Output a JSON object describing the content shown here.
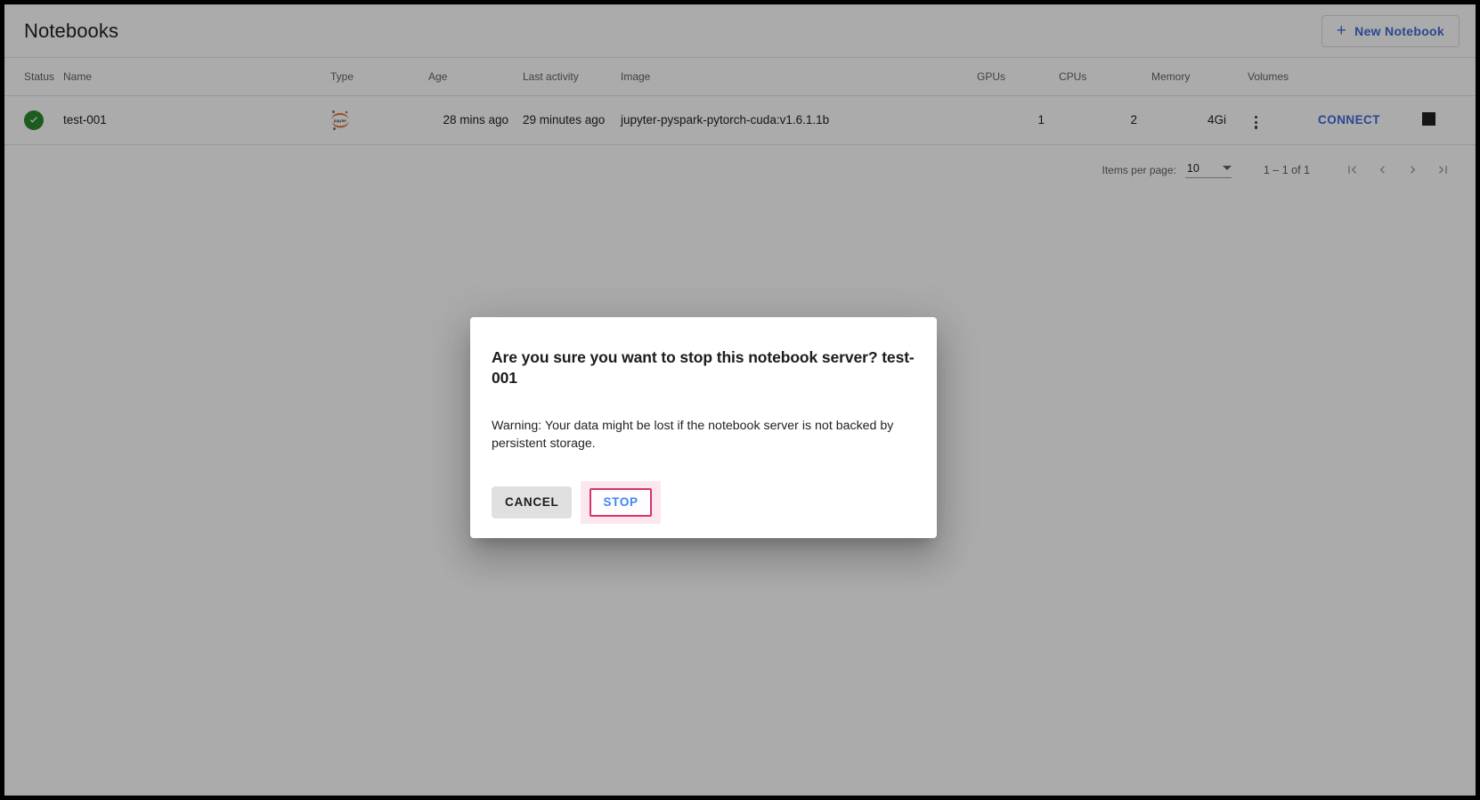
{
  "header": {
    "title": "Notebooks",
    "new_notebook_label": "New Notebook",
    "plus_icon": "plus-icon",
    "accent_color": "#3f6ad8"
  },
  "table": {
    "columns": [
      "Status",
      "Name",
      "Type",
      "Age",
      "Last activity",
      "Image",
      "GPUs",
      "CPUs",
      "Memory",
      "Volumes"
    ],
    "rows": [
      {
        "status_icon": "check-circle-icon",
        "status_color": "#2c8a2c",
        "name": "test-001",
        "type_icon": "jupyter-logo-icon",
        "age": "28 mins ago",
        "last_activity": "29 minutes ago",
        "image": "jupyter-pyspark-pytorch-cuda:v1.6.1.1b",
        "gpus": "1",
        "cpus": "2",
        "memory": "4Gi",
        "volumes_icon": "more-vert-icon",
        "connect_label": "CONNECT",
        "stop_icon": "stop-square-icon",
        "delete_icon": "trash-icon"
      }
    ]
  },
  "paginator": {
    "items_per_page_label": "Items per page:",
    "items_per_page_value": "10",
    "range_label": "1 – 1 of 1",
    "first_page_icon": "first-page-icon",
    "prev_page_icon": "chevron-left-icon",
    "next_page_icon": "chevron-right-icon",
    "last_page_icon": "last-page-icon"
  },
  "dialog": {
    "title": "Are you sure you want to stop this notebook server? test-001",
    "body": "Warning: Your data might be lost if the notebook server is not backed by persistent storage.",
    "cancel_label": "CANCEL",
    "stop_label": "STOP",
    "stop_border_color": "#d6336c",
    "stop_highlight_color": "#fce7ee",
    "stop_text_color": "#4285f4"
  }
}
